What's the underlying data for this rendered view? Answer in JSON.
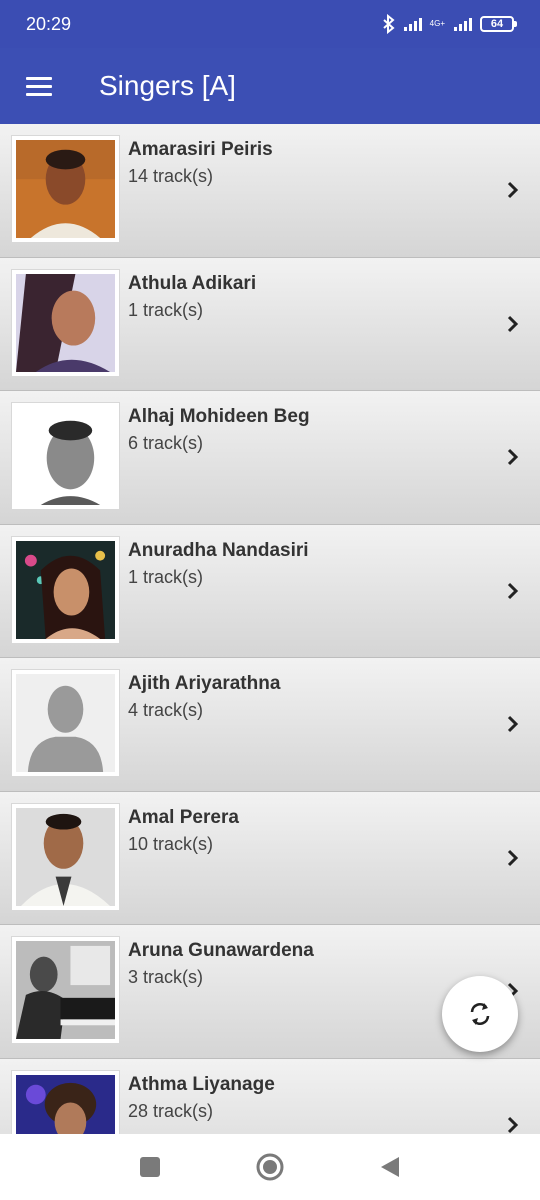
{
  "status_bar": {
    "time": "20:29",
    "network": "4G+",
    "battery": "64"
  },
  "app_bar": {
    "title": "Singers [A]"
  },
  "singers": [
    {
      "name": "Amarasiri Peiris",
      "tracks": "14 track(s)"
    },
    {
      "name": "Athula Adikari",
      "tracks": "1 track(s)"
    },
    {
      "name": "Alhaj Mohideen Beg",
      "tracks": "6 track(s)"
    },
    {
      "name": "Anuradha Nandasiri",
      "tracks": "1 track(s)"
    },
    {
      "name": "Ajith Ariyarathna",
      "tracks": "4 track(s)"
    },
    {
      "name": "Amal Perera",
      "tracks": "10 track(s)"
    },
    {
      "name": "Aruna Gunawardena",
      "tracks": "3 track(s)"
    },
    {
      "name": "Athma Liyanage",
      "tracks": "28 track(s)"
    }
  ],
  "colors": {
    "primary": "#3c4fb4",
    "status_bar": "#3b4db3"
  },
  "icons": {
    "menu": "hamburger-icon",
    "chevron": "chevron-right-icon",
    "refresh": "refresh-icon",
    "nav_recents": "square-icon",
    "nav_home": "circle-icon",
    "nav_back": "triangle-back-icon"
  }
}
